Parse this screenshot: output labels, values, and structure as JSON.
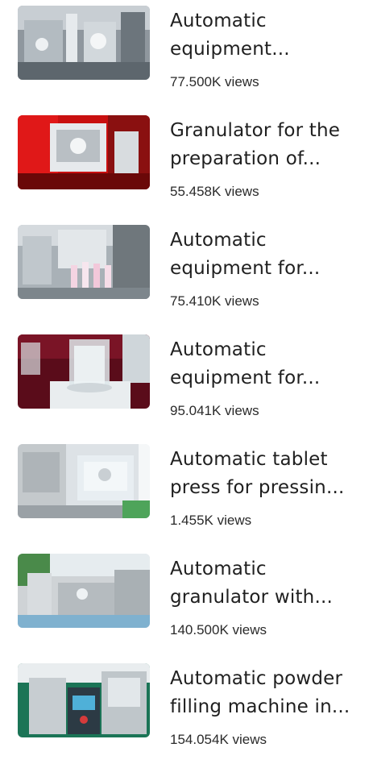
{
  "videos": [
    {
      "title": "Automatic\nequipment...",
      "views": "77.500K views",
      "thumbnail_icon": "machine-thumbnail",
      "thumb_colors": [
        "#9aa3ab",
        "#d7dde2",
        "#5b646c"
      ]
    },
    {
      "title": "Granulator for the\npreparation of...",
      "views": "55.458K views",
      "thumbnail_icon": "granulator-thumbnail",
      "thumb_colors": [
        "#d41616",
        "#e8eaec",
        "#7a0a0a"
      ]
    },
    {
      "title": "Automatic\nequipment for...",
      "views": "75.410K views",
      "thumbnail_icon": "tube-filling-thumbnail",
      "thumb_colors": [
        "#b9c0c6",
        "#f1d6e3",
        "#6b7378"
      ]
    },
    {
      "title": "Automatic\nequipment for...",
      "views": "95.041K views",
      "thumbnail_icon": "stirrer-thumbnail",
      "thumb_colors": [
        "#6e1020",
        "#dfe6ea",
        "#3d0a12"
      ]
    },
    {
      "title": "Automatic tablet\npress for pressin...",
      "views": "1.455K views",
      "thumbnail_icon": "tablet-press-thumbnail",
      "thumb_colors": [
        "#c9cdd0",
        "#e9eef2",
        "#55a85a"
      ]
    },
    {
      "title": "Automatic\ngranulator with...",
      "views": "140.500K views",
      "thumbnail_icon": "granulator-line-thumbnail",
      "thumb_colors": [
        "#c7cbcd",
        "#7fb3d3",
        "#3d7a3e"
      ]
    },
    {
      "title": "Automatic powder\nfilling machine in...",
      "views": "154.054K views",
      "thumbnail_icon": "powder-filler-thumbnail",
      "thumb_colors": [
        "#1d7d5a",
        "#d4d9dc",
        "#2b3a44"
      ]
    }
  ]
}
